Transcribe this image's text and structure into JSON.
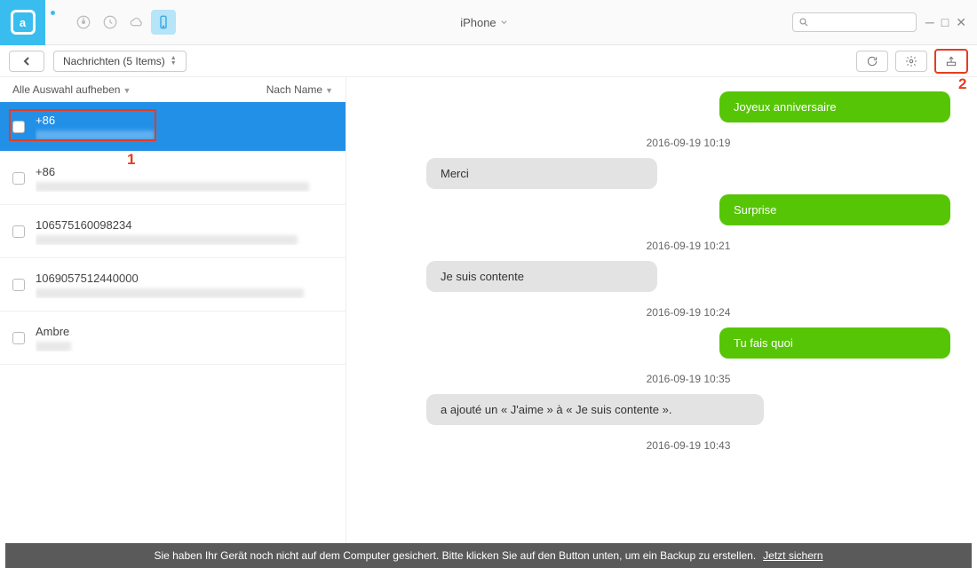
{
  "header": {
    "device_title": "iPhone",
    "search_placeholder": ""
  },
  "breadcrumb": {
    "label": "Nachrichten (5 Items)"
  },
  "list_header": {
    "deselect_all": "Alle Auswahl aufheben",
    "sort_label": "Nach Name"
  },
  "conversations": [
    {
      "title": "+86"
    },
    {
      "title": "+86"
    },
    {
      "title": "106575160098234"
    },
    {
      "title": "1069057512440000"
    },
    {
      "title": "Ambre"
    }
  ],
  "messages": [
    {
      "type": "out",
      "text": "Joyeux anniversaire"
    },
    {
      "type": "ts",
      "text": "2016-09-19 10:19"
    },
    {
      "type": "in",
      "text": "Merci"
    },
    {
      "type": "out",
      "text": "Surprise"
    },
    {
      "type": "ts",
      "text": "2016-09-19 10:21"
    },
    {
      "type": "in",
      "text": "Je suis contente"
    },
    {
      "type": "ts",
      "text": "2016-09-19 10:24"
    },
    {
      "type": "out",
      "text": "Tu fais quoi"
    },
    {
      "type": "ts",
      "text": "2016-09-19 10:35"
    },
    {
      "type": "in_wide",
      "text": "a ajouté un « J'aime » à « Je suis contente  »."
    },
    {
      "type": "ts",
      "text": "2016-09-19 10:43"
    }
  ],
  "footer": {
    "text": "Sie haben Ihr Gerät noch nicht auf dem Computer gesichert. Bitte klicken Sie auf den Button unten, um ein Backup zu erstellen.",
    "link": "Jetzt sichern"
  },
  "annotations": {
    "step1": "1",
    "step2": "2"
  }
}
